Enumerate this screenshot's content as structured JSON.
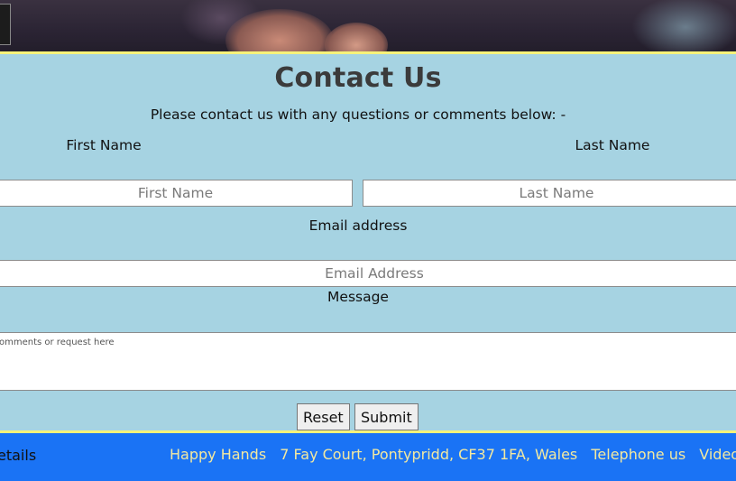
{
  "page": {
    "title": "Contact Us",
    "intro": "Please contact us with any questions or comments below: -"
  },
  "form": {
    "first_name_label": "First Name",
    "first_name_placeholder": "First Name",
    "last_name_label": "Last Name",
    "last_name_placeholder": "Last Name",
    "email_label": "Email address",
    "email_placeholder": "Email Address",
    "message_label": "Message",
    "message_placeholder": "omments or request here",
    "reset_label": "Reset",
    "submit_label": "Submit"
  },
  "footer": {
    "left_text": "etails",
    "links": [
      "Happy Hands",
      "7 Fay Court, Pontypridd, CF37 1FA, Wales",
      "Telephone us",
      "Video Co"
    ]
  },
  "colors": {
    "page_background": "#a6d3e2",
    "accent_border": "#f6f27a",
    "footer_background": "#1a73f5",
    "footer_link": "#f3e9a0"
  }
}
